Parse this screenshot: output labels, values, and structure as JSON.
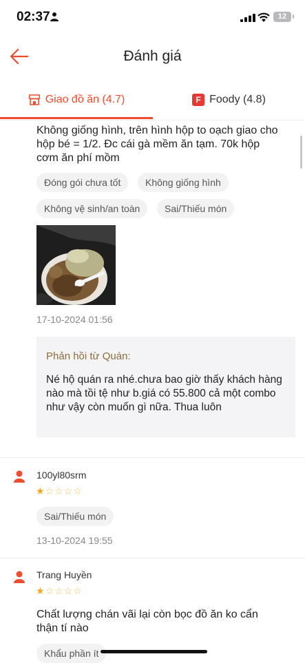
{
  "status_bar": {
    "time": "02:37",
    "battery": "12"
  },
  "header": {
    "title": "Đánh giá"
  },
  "tabs": [
    {
      "label": "Giao đồ ăn (4.7)",
      "icon": "shop-icon",
      "active": true
    },
    {
      "label": "Foody (4.8)",
      "icon": "foody-logo-icon",
      "icon_letter": "F",
      "active": false
    }
  ],
  "reviews": [
    {
      "text": "Không giống hình, trên hình hộp to oạch giao cho hộp bé = 1/2. Đc cái gà mềm ăn tạm. 70k hộp cơm ăn phí mồm",
      "tags": [
        "Đóng gói chưa tốt",
        "Không giống hình",
        "Không vệ sinh/an toàn",
        "Sai/Thiếu món"
      ],
      "date": "17-10-2024 01:56",
      "reply": {
        "title": "Phản hồi từ Quán:",
        "text": "Né hộ quán ra nhé.chưa bao giờ thấy khách hàng nào mà tồi tệ như b.giá có 55.800 cả một combo như vậy còn muốn gì nữa. Thua luôn"
      }
    },
    {
      "user": "100yl80srm",
      "rating": 1,
      "rating_max": 5,
      "tags": [
        "Sai/Thiếu món"
      ],
      "date": "13-10-2024 19:55"
    },
    {
      "user": "Trang Huyền",
      "rating": 1,
      "rating_max": 5,
      "text": "Chất lượng chán vãi lại còn bọc đồ ăn ko cẩn thận tí nào",
      "tags": [
        "Khẩu phần ít"
      ]
    }
  ],
  "colors": {
    "accent": "#ee4d2d",
    "star": "#f5a623",
    "reply_bg": "#f4f4f6"
  }
}
